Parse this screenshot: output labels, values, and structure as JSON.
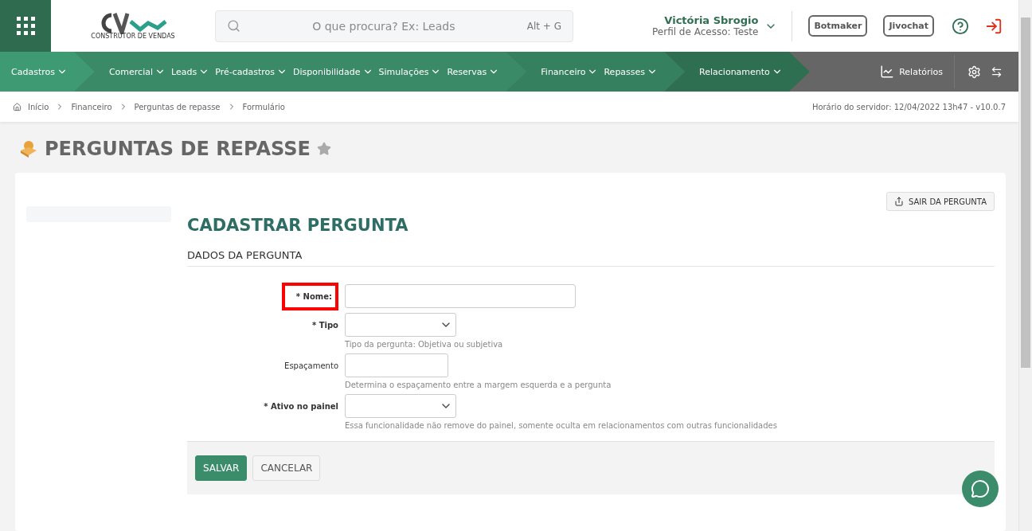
{
  "header": {
    "logo_caption": "CONSTRUTOR DE VENDAS",
    "search": {
      "placeholder": "O que procura? Ex: Leads",
      "shortcut": "Alt + G"
    },
    "user": {
      "name": "Victória Sbrogio",
      "profile": "Perfil de Acesso: Teste"
    },
    "buttons": [
      "Botmaker",
      "Jivochat"
    ]
  },
  "nav": {
    "groups": [
      {
        "items": [
          "Cadastros"
        ]
      },
      {
        "items": [
          "Comercial",
          "Leads",
          "Pré-cadastros",
          "Disponibilidade",
          "Simulações",
          "Reservas"
        ]
      },
      {
        "items": [
          "Financeiro",
          "Repasses"
        ]
      },
      {
        "items": [
          "Relacionamento"
        ]
      }
    ],
    "reports": "Relatórios"
  },
  "breadcrumb": [
    "Início",
    "Financeiro",
    "Perguntas de repasse",
    "Formulário"
  ],
  "server_time": "Horário do servidor: 12/04/2022 13h47 - v10.0.7",
  "page_title": "PERGUNTAS DE REPASSE",
  "exit_button": "SAIR DA PERGUNTA",
  "form_title": "CADASTRAR PERGUNTA",
  "section_title": "DADOS DA PERGUNTA",
  "fields": [
    {
      "label": "* Nome:",
      "kind": "input",
      "highlighted": true
    },
    {
      "label": "* Tipo",
      "kind": "select",
      "highlighted": false,
      "help": "Tipo da pergunta: Objetiva ou subjetiva"
    },
    {
      "label": "Espaçamento",
      "kind": "input",
      "highlighted": false,
      "help": "Determina o espaçamento entre a margem esquerda e a pergunta"
    },
    {
      "label": "* Ativo no painel",
      "kind": "select",
      "highlighted": false,
      "help": "Essa funcionalidade não remove do painel, somente oculta em relacionamentos com outras funcionalidades"
    }
  ],
  "actions": [
    {
      "label": "SALVAR",
      "kind": "primary"
    },
    {
      "label": "CANCELAR",
      "kind": "secondary"
    }
  ]
}
